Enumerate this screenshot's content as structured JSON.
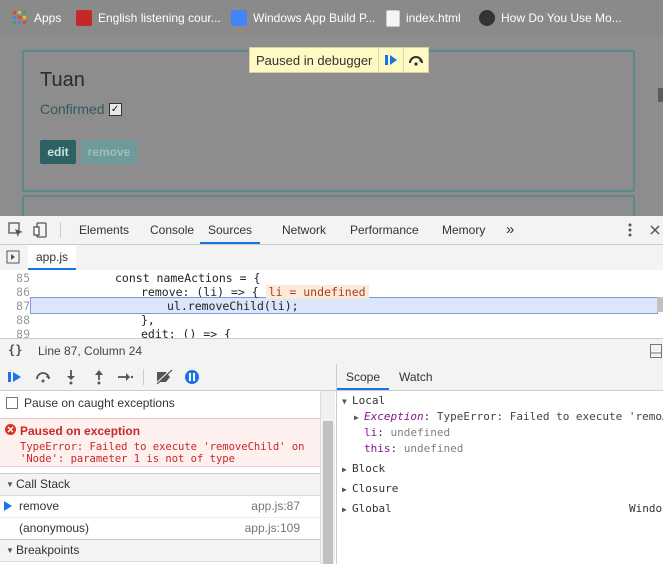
{
  "bookmarks": [
    {
      "label": "Apps",
      "icon": "apps-grid-icon"
    },
    {
      "label": "English listening cour...",
      "icon": "bookmark-red-icon"
    },
    {
      "label": "Windows App Build P...",
      "icon": "google-doc-icon"
    },
    {
      "label": "index.html",
      "icon": "file-icon"
    },
    {
      "label": "How Do You Use Mo...",
      "icon": "site-favicon-icon"
    }
  ],
  "page": {
    "person_name": "Tuan",
    "confirmed_label": "Confirmed",
    "confirmed_checked": "✓",
    "edit_label": "edit",
    "remove_label": "remove"
  },
  "debugger_banner": {
    "text": "Paused in debugger"
  },
  "devtools": {
    "tabs": [
      "Elements",
      "Console",
      "Sources",
      "Network",
      "Performance",
      "Memory"
    ],
    "active_tab": "Sources",
    "more_tabs": "»",
    "file_tab": "app.js",
    "status_braces": "{}",
    "position": "Line 87, Column 24"
  },
  "code": {
    "lines": [
      {
        "num": "85",
        "text": "const nameActions = {"
      },
      {
        "num": "86",
        "text": "remove: (li) => {",
        "inline": "li = undefined"
      },
      {
        "num": "87",
        "text": "ul.removeChild(li);"
      },
      {
        "num": "88",
        "text": "},"
      },
      {
        "num": "89",
        "text": "edit: () => {"
      }
    ]
  },
  "debugger": {
    "pause_caught_label": "Pause on caught exceptions",
    "exception_title": "Paused on exception",
    "exception_message": "TypeError: Failed to execute 'removeChild' on 'Node': parameter 1 is not of type",
    "call_stack_label": "Call Stack",
    "call_stack": [
      {
        "fn": "remove",
        "loc": "app.js:87"
      },
      {
        "fn": "(anonymous)",
        "loc": "app.js:109"
      }
    ],
    "breakpoints_label": "Breakpoints"
  },
  "scope": {
    "tabs": [
      "Scope",
      "Watch"
    ],
    "local_label": "Local",
    "exception_name": "Exception",
    "exception_value": "TypeError: Failed to execute 'remo…",
    "li_name": "li",
    "li_value": "undefined",
    "this_name": "this",
    "this_value": "undefined",
    "block_label": "Block",
    "closure_label": "Closure",
    "global_label": "Global",
    "global_value": "Windo"
  },
  "colors": {
    "accent": "#1a73e8",
    "error": "#c62828",
    "banner": "#fff9c4"
  }
}
